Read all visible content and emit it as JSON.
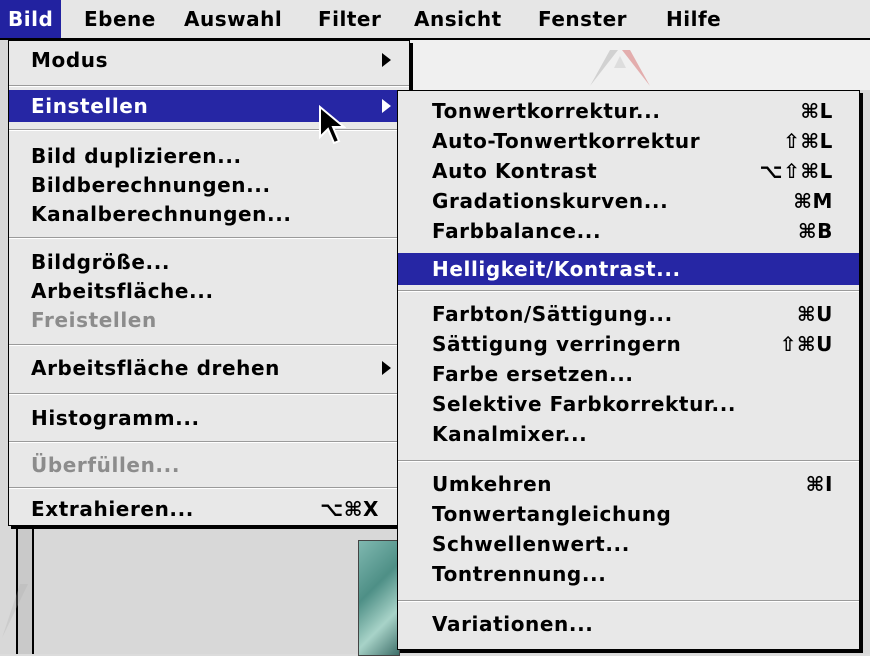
{
  "menubar": {
    "items": [
      {
        "label": "Bild"
      },
      {
        "label": "Ebene"
      },
      {
        "label": "Auswahl"
      },
      {
        "label": "Filter"
      },
      {
        "label": "Ansicht"
      },
      {
        "label": "Fenster"
      },
      {
        "label": "Hilfe"
      }
    ]
  },
  "bild_menu": {
    "items": [
      {
        "label": "Modus"
      },
      {
        "label": "Einstellen"
      },
      {
        "label": "Bild duplizieren..."
      },
      {
        "label": "Bildberechnungen..."
      },
      {
        "label": "Kanalberechnungen..."
      },
      {
        "label": "Bildgröße..."
      },
      {
        "label": "Arbeitsfläche..."
      },
      {
        "label": "Freistellen"
      },
      {
        "label": "Arbeitsfläche drehen"
      },
      {
        "label": "Histogramm..."
      },
      {
        "label": "Überfüllen..."
      },
      {
        "label": "Extrahieren...",
        "shortcut": "⌥⌘X"
      }
    ]
  },
  "einstellen_menu": {
    "items": [
      {
        "label": "Tonwertkorrektur...",
        "shortcut": "⌘L"
      },
      {
        "label": "Auto-Tonwertkorrektur",
        "shortcut": "⇧⌘L"
      },
      {
        "label": "Auto Kontrast",
        "shortcut": "⌥⇧⌘L"
      },
      {
        "label": "Gradationskurven...",
        "shortcut": "⌘M"
      },
      {
        "label": "Farbbalance...",
        "shortcut": "⌘B"
      },
      {
        "label": "Helligkeit/Kontrast..."
      },
      {
        "label": "Farbton/Sättigung...",
        "shortcut": "⌘U"
      },
      {
        "label": "Sättigung verringern",
        "shortcut": "⇧⌘U"
      },
      {
        "label": "Farbe ersetzen..."
      },
      {
        "label": "Selektive Farbkorrektur..."
      },
      {
        "label": "Kanalmixer..."
      },
      {
        "label": "Umkehren",
        "shortcut": "⌘I"
      },
      {
        "label": "Tonwertangleichung"
      },
      {
        "label": "Schwellenwert..."
      },
      {
        "label": "Tontrennung..."
      },
      {
        "label": "Variationen..."
      }
    ]
  },
  "colors": {
    "highlight": "#2626a4",
    "menu_bg": "#e8e8e8",
    "disabled_text": "#8c8c8c"
  }
}
